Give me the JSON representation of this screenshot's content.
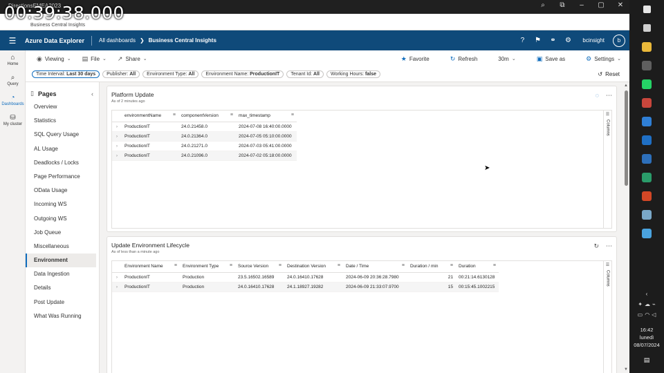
{
  "overlay": {
    "timer": "00:39:38.000"
  },
  "browser": {
    "title": "DirectionsEMEA2023",
    "tab_title": "Business Central Insights"
  },
  "header": {
    "app_name": "Azure Data Explorer",
    "breadcrumb_root": "All dashboards",
    "breadcrumb_chevron": "❯",
    "breadcrumb_current": "Business Central Insights",
    "user_name": "bcinsight",
    "avatar_initial": "b"
  },
  "rail": {
    "items": [
      {
        "label": "Home"
      },
      {
        "label": "Query"
      },
      {
        "label": "Dashboards"
      },
      {
        "label": "My cluster"
      }
    ]
  },
  "toolbar": {
    "viewing": "Viewing",
    "file": "File",
    "share": "Share",
    "favorite": "Favorite",
    "refresh": "Refresh",
    "interval": "30m",
    "save_as": "Save as",
    "settings": "Settings"
  },
  "filters": {
    "chips": [
      {
        "label": "Time Interval:",
        "value": "Last 30 days"
      },
      {
        "label": "Publisher:",
        "value": "All"
      },
      {
        "label": "Environment Type:",
        "value": "All"
      },
      {
        "label": "Environment Name:",
        "value": "ProductionIT"
      },
      {
        "label": "Tenant Id:",
        "value": "All"
      },
      {
        "label": "Working Hours:",
        "value": "false"
      }
    ],
    "reset": "Reset"
  },
  "pages": {
    "title": "Pages",
    "items": [
      "Overview",
      "Statistics",
      "SQL Query Usage",
      "AL Usage",
      "Deadlocks / Locks",
      "Page Performance",
      "OData Usage",
      "Incoming WS",
      "Outgoing WS",
      "Job Queue",
      "Miscellaneous",
      "Environment",
      "Data Ingestion",
      "Details",
      "Post Update",
      "What Was Running"
    ],
    "active": "Environment"
  },
  "tile1": {
    "title": "Platform Update",
    "subtitle": "As of 2 minutes ago",
    "columns_label": "Columns",
    "headers": [
      "environmentName",
      "componentVersion",
      "max_timestamp"
    ],
    "rows": [
      [
        "ProductionIT",
        "24.0.21458.0",
        "2024-07-08 16:40:00.0000"
      ],
      [
        "ProductionIT",
        "24.0.21364.0",
        "2024-07-05 05:10:00.0000"
      ],
      [
        "ProductionIT",
        "24.0.21271.0",
        "2024-07-03 05:41:00.0000"
      ],
      [
        "ProductionIT",
        "24.0.21096.0",
        "2024-07-02 05:18:00.0000"
      ]
    ]
  },
  "tile2": {
    "title": "Update Environment Lifecycle",
    "subtitle": "As of less than a minute ago",
    "columns_label": "Columns",
    "headers": [
      "Environment Name",
      "Environment Type",
      "Source Version",
      "Destination Version",
      "Date / Time",
      "Duration / min",
      "Duration"
    ],
    "rows": [
      [
        "ProductionIT",
        "Production",
        "23.5.16502.16589",
        "24.0.16410.17628",
        "2024-06-09 20:36:28.7980",
        "21",
        "00:21:14.6130128"
      ],
      [
        "ProductionIT",
        "Production",
        "24.0.16410.17628",
        "24.1.18927.19282",
        "2024-06-09 21:33:07.9700",
        "15",
        "00:15:45.1002215"
      ]
    ]
  },
  "taskbar": {
    "time": "16:42",
    "day": "lunedì",
    "date": "08/07/2024",
    "app_colors": [
      "#e6e6e6",
      "#cfcfcf",
      "#e9b83a",
      "#5f5f5f",
      "#25d366",
      "#c8463c",
      "#2f7fd6",
      "#1f6fc4",
      "#2d6fba",
      "#2a9c6a",
      "#d24726",
      "#7aa8c8",
      "#4aa3df"
    ]
  }
}
